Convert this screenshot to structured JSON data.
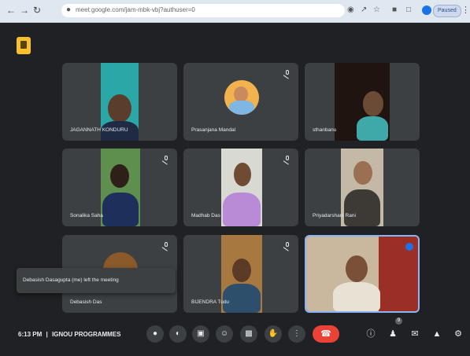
{
  "browser": {
    "back_icon": "arrow-left-icon",
    "forward_icon": "arrow-right-icon",
    "reload_icon": "reload-icon",
    "url": "meet.google.com/jam-mbk-vbj?authuser=0",
    "profile_label": "Paused"
  },
  "meeting": {
    "time": "6:13 PM",
    "separator": "|",
    "title": "IGNOU PROGRAMMES",
    "toast_text": "Debasish Dasagupta (me) left the meeting",
    "participants": [
      {
        "name": "JAGANNATH KONDURU",
        "muted": false
      },
      {
        "name": "Prasanjana Mandal",
        "muted": true
      },
      {
        "name": "sthanbanu",
        "muted": false
      },
      {
        "name": "Sonalika Saha",
        "muted": true
      },
      {
        "name": "Madhab Das",
        "muted": true
      },
      {
        "name": "Priyadarshani Rani",
        "muted": false
      },
      {
        "name": "Debasish Das",
        "muted": true
      },
      {
        "name": "BIJENDRA Tudu",
        "muted": true
      },
      {
        "name": "",
        "muted": false,
        "speaking": true
      }
    ]
  },
  "controls": {
    "mic": "mic-icon",
    "captions": "captions-icon",
    "cam": "camera-icon",
    "emoji": "emoji-icon",
    "present": "present-screen-icon",
    "raise_hand": "raise-hand-icon",
    "more": "more-options-icon",
    "end_call": "end-call-icon",
    "info": "info-icon",
    "people": "people-icon",
    "people_count": "9",
    "chat": "chat-icon",
    "activities": "activities-icon",
    "host_controls": "host-controls-icon"
  },
  "colors": {
    "meet_bg": "#202124",
    "tile_bg": "#3c4043",
    "end_call": "#ea4335",
    "active_border": "#8ab4f8",
    "logo": "#f9c02e"
  }
}
